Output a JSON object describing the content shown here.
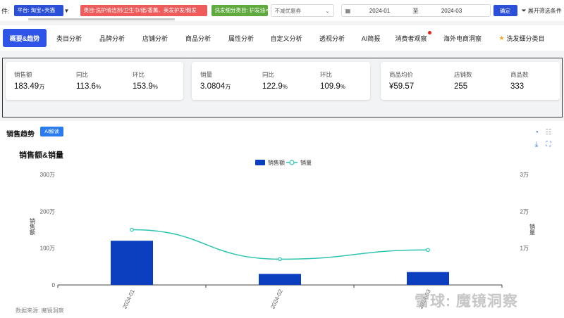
{
  "filter_bar": {
    "prefix": "件:",
    "platform": "平台: 淘宝+天猫",
    "category": "类目:洗护清洁剂/卫生巾/纸/香薰、美发护发/假发",
    "subcategory": "洗发细分类目: 护发油",
    "subcategory_close": "×",
    "discount_select": "不减优惠券",
    "date_start": "2024-01",
    "date_sep": "至",
    "date_end": "2024-03",
    "confirm_label": "确定",
    "expand_label": "展开筛选条件"
  },
  "tabs": [
    {
      "label": "概要&趋势",
      "active": true
    },
    {
      "label": "类目分析"
    },
    {
      "label": "品牌分析"
    },
    {
      "label": "店铺分析"
    },
    {
      "label": "商品分析"
    },
    {
      "label": "属性分析"
    },
    {
      "label": "自定义分析"
    },
    {
      "label": "透视分析"
    },
    {
      "label": "AI简报"
    },
    {
      "label": "消费者观察",
      "badge": true
    },
    {
      "label": "海外电商洞察"
    },
    {
      "label": "洗发细分类目",
      "starred": true
    }
  ],
  "metrics": {
    "sales": {
      "label": "销售额",
      "value": "183.49",
      "unit": "万"
    },
    "sales_yoy": {
      "label": "同比",
      "value": "113.6",
      "unit": "%"
    },
    "sales_mom": {
      "label": "环比",
      "value": "153.9",
      "unit": "%"
    },
    "volume": {
      "label": "销量",
      "value": "3.0804",
      "unit": "万"
    },
    "volume_yoy": {
      "label": "同比",
      "value": "122.9",
      "unit": "%"
    },
    "volume_mom": {
      "label": "环比",
      "value": "109.9",
      "unit": "%"
    },
    "avg_price": {
      "label": "商品均价",
      "value": "¥59.57"
    },
    "shops": {
      "label": "店铺数",
      "value": "255"
    },
    "products": {
      "label": "商品数",
      "value": "333"
    }
  },
  "section": {
    "title": "销售趋势",
    "ai_label": "AI解读",
    "source": "数据来源: 魔镜洞察",
    "watermark": "雪球: 魔镜洞察"
  },
  "colors": {
    "accent": "#2f54e8",
    "bar": "#0b3fbf",
    "line": "#2ec4b0"
  },
  "chart_data": {
    "type": "bar",
    "title": "销售额&销量",
    "categories": [
      "2024-01",
      "2024-02",
      "2024-03"
    ],
    "series": [
      {
        "name": "销售额",
        "type": "bar",
        "axis": "left",
        "values": [
          1200000,
          300000,
          350000
        ]
      },
      {
        "name": "销量",
        "type": "line",
        "axis": "right",
        "values": [
          15000,
          7000,
          9500
        ]
      }
    ],
    "ylabel": "销售额",
    "y2label": "销量",
    "ylim": [
      0,
      3000000
    ],
    "y2lim": [
      0,
      30000
    ],
    "yticks": [
      "0",
      "100万",
      "200万",
      "300万"
    ],
    "y2ticks": [
      "",
      "1万",
      "2万",
      "3万"
    ],
    "grid": false,
    "legend": "top-center"
  }
}
